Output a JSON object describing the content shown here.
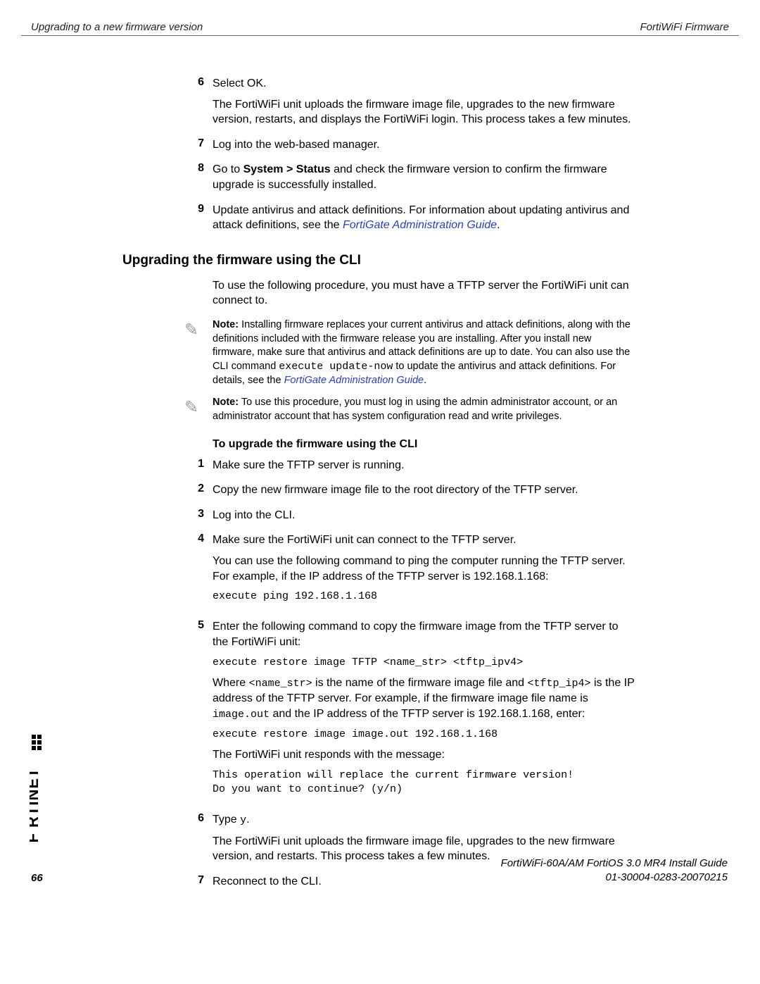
{
  "header": {
    "left": "Upgrading to a new firmware version",
    "right": "FortiWiFi Firmware"
  },
  "topSteps": [
    {
      "n": "6",
      "paras": [
        "Select OK.",
        "The FortiWiFi unit uploads the firmware image file, upgrades to the new firmware version, restarts, and displays the FortiWiFi login. This process takes a few minutes."
      ]
    },
    {
      "n": "7",
      "paras": [
        "Log into the web-based manager."
      ]
    },
    {
      "n": "8",
      "html": "Go to <b>System > Status</b> and check the firmware version to confirm the firmware upgrade is successfully installed."
    },
    {
      "n": "9",
      "html": "Update antivirus and attack definitions. For information about updating antivirus and attack definitions, see the <span class=\"link\">FortiGate Administration Guide</span>."
    }
  ],
  "section": {
    "title": "Upgrading the firmware using the CLI",
    "intro": "To use the following procedure, you must have a TFTP server the FortiWiFi unit can connect to.",
    "notes": [
      "<b>Note:</b> Installing firmware replaces your current antivirus and attack definitions, along with the definitions included with the firmware release you are installing. After you install new firmware, make sure that antivirus and attack definitions are up to date. You can also use the CLI command <span class=\"code\">execute update-now</span> to update the antivirus and attack definitions. For details, see the <span class=\"link\">FortiGate Administration Guide</span>.",
      "<b>Note:</b> To use this procedure, you must log in using the admin administrator account, or an administrator account that has system configuration read and write privileges."
    ],
    "subhead": "To upgrade the firmware using the CLI",
    "steps": [
      {
        "n": "1",
        "paras": [
          "Make sure the TFTP server is running."
        ]
      },
      {
        "n": "2",
        "paras": [
          "Copy the new firmware image file to the root directory of the TFTP server."
        ]
      },
      {
        "n": "3",
        "paras": [
          "Log into the CLI."
        ]
      },
      {
        "n": "4",
        "blocks": [
          {
            "t": "p",
            "v": "Make sure the FortiWiFi unit can connect to the TFTP server."
          },
          {
            "t": "p",
            "v": "You can use the following command to ping the computer running the TFTP server. For example, if the IP address of the TFTP server is 192.168.1.168:"
          },
          {
            "t": "pre",
            "v": "execute ping 192.168.1.168"
          }
        ]
      },
      {
        "n": "5",
        "blocks": [
          {
            "t": "p",
            "v": "Enter the following command to copy the firmware image from the TFTP server to the FortiWiFi unit:"
          },
          {
            "t": "pre",
            "v": "execute restore image TFTP <name_str> <tftp_ipv4>"
          },
          {
            "t": "html",
            "v": "Where <span class=\"code\">&lt;name_str&gt;</span> is the name of the firmware image file and <span class=\"code\">&lt;tftp_ip4&gt;</span> is the IP address of the TFTP server. For example, if the firmware image file name is <span class=\"code\">image.out</span> and the IP address of the TFTP server is 192.168.1.168, enter:"
          },
          {
            "t": "pre",
            "v": "execute restore image image.out 192.168.1.168"
          },
          {
            "t": "p",
            "v": "The FortiWiFi unit responds with the message:"
          },
          {
            "t": "pre",
            "v": "This operation will replace the current firmware version!\nDo you want to continue? (y/n)"
          }
        ]
      },
      {
        "n": "6",
        "blocks": [
          {
            "t": "html",
            "v": "Type <span class=\"code\">y</span>."
          },
          {
            "t": "p",
            "v": "The FortiWiFi unit uploads the firmware image file, upgrades to the new firmware version, and restarts. This process takes a few minutes."
          }
        ]
      },
      {
        "n": "7",
        "paras": [
          "Reconnect to the CLI."
        ]
      }
    ]
  },
  "footer": {
    "line1": "FortiWiFi-60A/AM FortiOS 3.0 MR4 Install Guide",
    "line2": "01-30004-0283-20070215",
    "page": "66"
  }
}
